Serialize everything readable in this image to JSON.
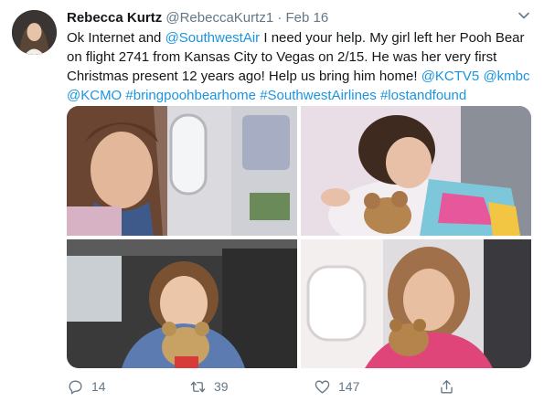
{
  "tweet": {
    "display_name": "Rebecca Kurtz",
    "handle": "@RebeccaKurtz1",
    "separator": "·",
    "date": "Feb 16",
    "text_parts": [
      {
        "t": "Ok Internet and ",
        "link": false
      },
      {
        "t": "@SouthwestAir",
        "link": true
      },
      {
        "t": " I need your help. My girl left her Pooh Bear on flight 2741 from Kansas City to Vegas on 2/15. He was her very first Christmas present 12 years ago! Help us bring him home! ",
        "link": false
      },
      {
        "t": "@KCTV5",
        "link": true
      },
      {
        "t": " ",
        "link": false
      },
      {
        "t": "@kmbc",
        "link": true
      },
      {
        "t": " ",
        "link": false
      },
      {
        "t": "@KCMO",
        "link": true
      },
      {
        "t": " ",
        "link": false
      },
      {
        "t": "#bringpoohbearhome",
        "link": true
      },
      {
        "t": " ",
        "link": false
      },
      {
        "t": "#SouthwestAirlines",
        "link": true
      },
      {
        "t": " ",
        "link": false
      },
      {
        "t": "#lostandfound",
        "link": true
      }
    ],
    "photos": [
      "girl-by-airplane-window",
      "girl-sleeping-with-bear",
      "girl-in-car-with-bear",
      "girl-hugging-bear-in-plane"
    ]
  },
  "actions": {
    "reply_count": "14",
    "retweet_count": "39",
    "like_count": "147",
    "icons": [
      "reply-icon",
      "retweet-icon",
      "like-icon",
      "share-icon"
    ]
  },
  "colors": {
    "link": "#1b95e0",
    "text": "#14171a",
    "muted": "#657786"
  }
}
